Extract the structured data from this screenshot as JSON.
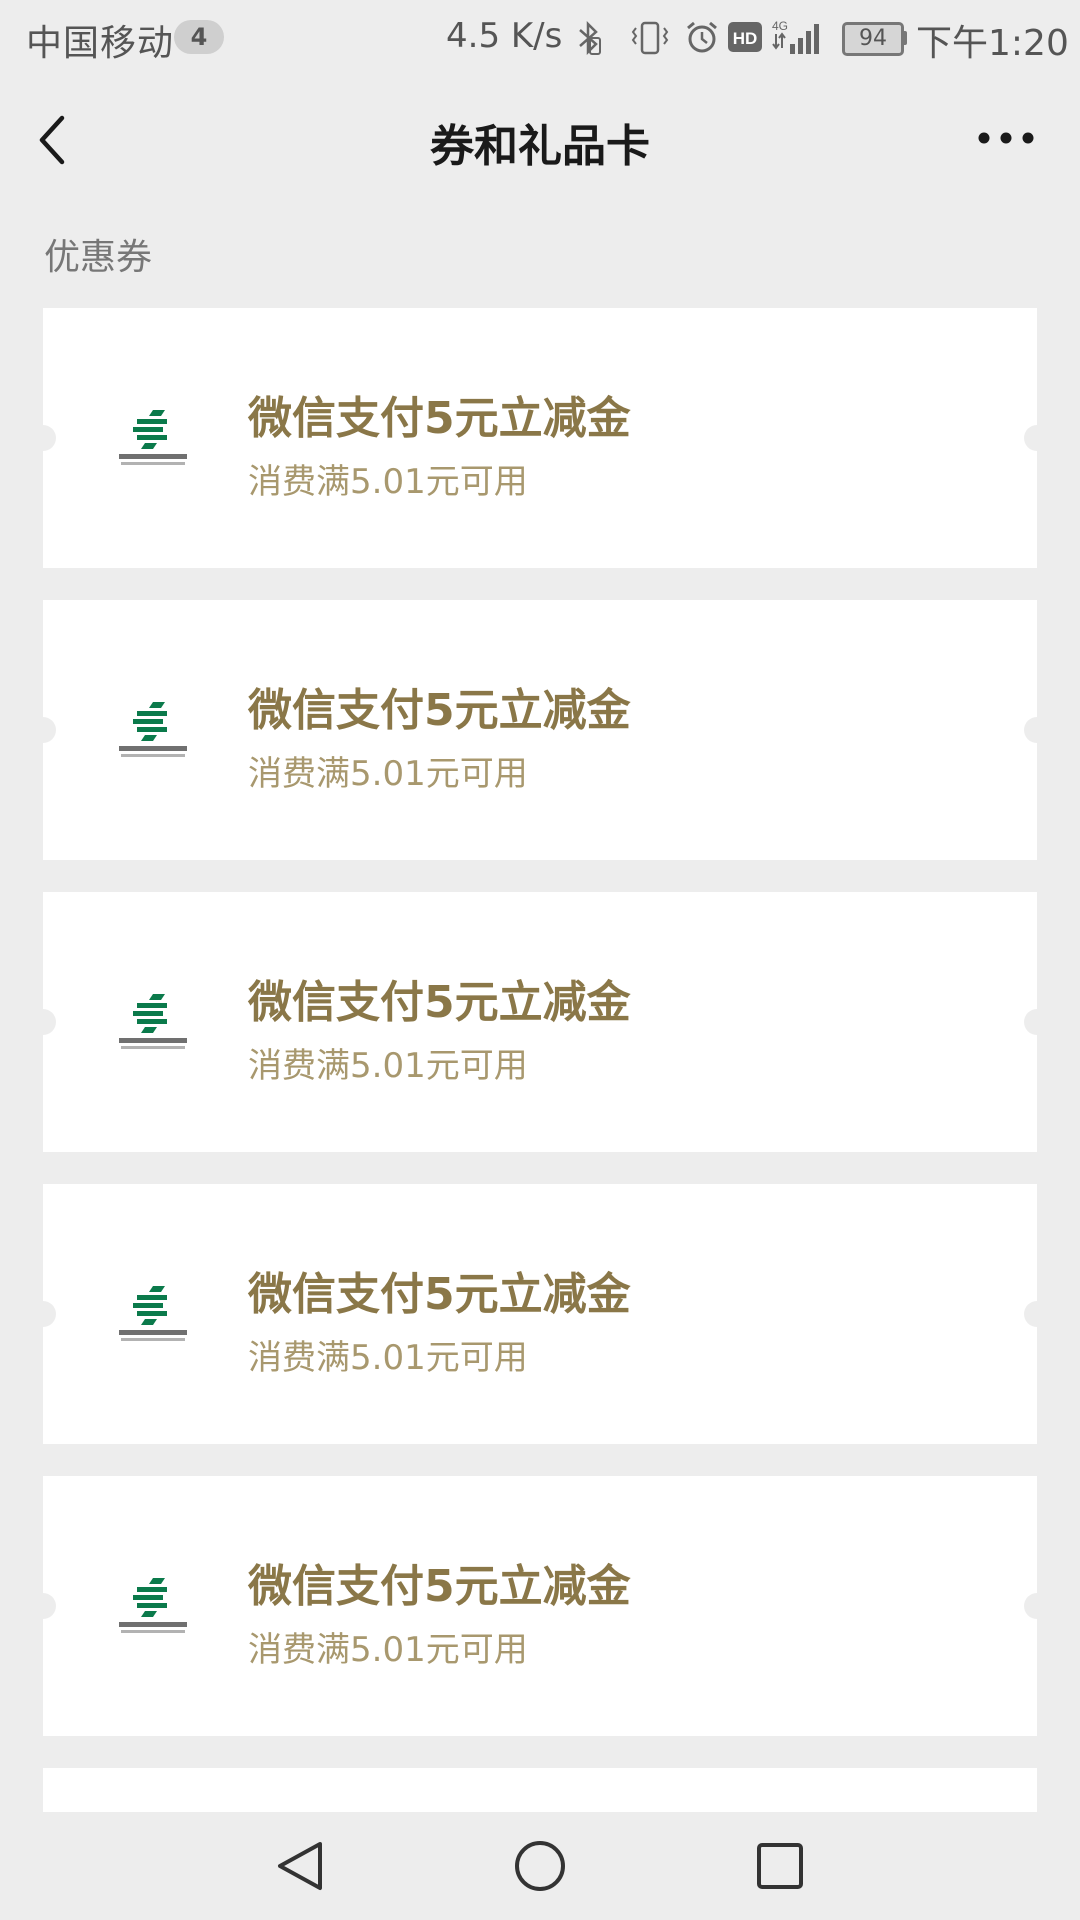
{
  "status_bar": {
    "carrier": "中国移动",
    "sim_badge": "4",
    "network_speed": "4.5 K/s",
    "battery_level": "94",
    "time": "下午1:20",
    "icons": [
      "bluetooth-icon",
      "vibrate-icon",
      "alarm-icon",
      "hd-icon",
      "4g-signal-icon"
    ]
  },
  "nav": {
    "title": "券和礼品卡",
    "back_icon": "chevron-left-icon",
    "more_icon": "more-dots-icon"
  },
  "section": {
    "label": "优惠券"
  },
  "coupons": [
    {
      "title": "微信支付5元立减金",
      "subtitle": "消费满5.01元可用",
      "logo": "postal-savings-bank-logo"
    },
    {
      "title": "微信支付5元立减金",
      "subtitle": "消费满5.01元可用",
      "logo": "postal-savings-bank-logo"
    },
    {
      "title": "微信支付5元立减金",
      "subtitle": "消费满5.01元可用",
      "logo": "postal-savings-bank-logo"
    },
    {
      "title": "微信支付5元立减金",
      "subtitle": "消费满5.01元可用",
      "logo": "postal-savings-bank-logo"
    },
    {
      "title": "微信支付5元立减金",
      "subtitle": "消费满5.01元可用",
      "logo": "postal-savings-bank-logo"
    }
  ],
  "colors": {
    "background": "#ededed",
    "card": "#ffffff",
    "coupon_title": "#8a7748",
    "coupon_subtitle": "#a8986e",
    "logo_green": "#0b7a4b"
  },
  "android_nav": {
    "back_icon": "triangle-back-icon",
    "home_icon": "circle-home-icon",
    "recents_icon": "square-recents-icon"
  }
}
